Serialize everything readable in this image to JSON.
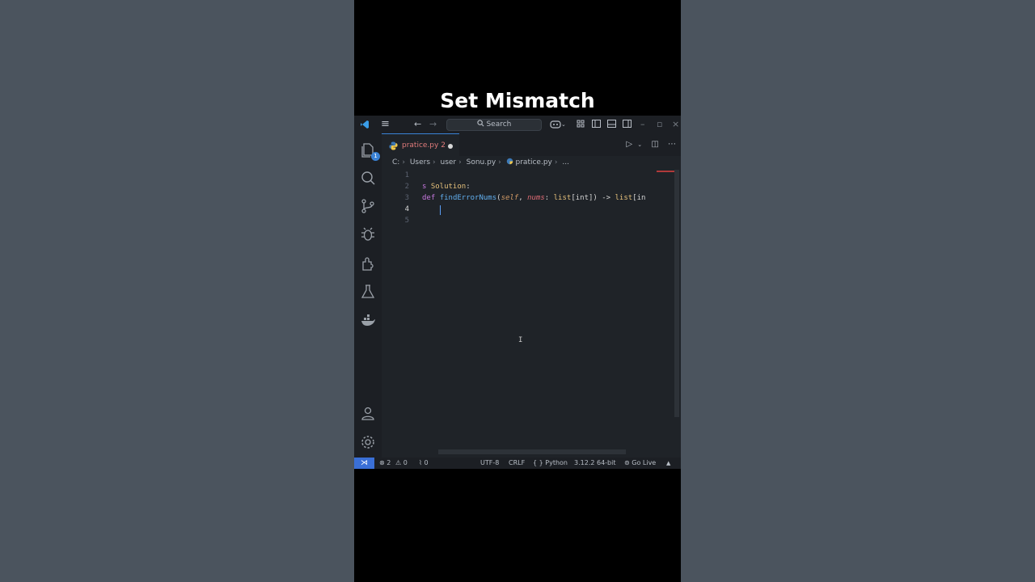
{
  "video": {
    "title": "Set Mismatch"
  },
  "titlebar": {
    "search_placeholder": "Search",
    "back_glyph": "←",
    "forward_glyph": "→",
    "minimize_glyph": "–",
    "maximize_glyph": "▫",
    "close_glyph": "×"
  },
  "activity": {
    "explorer_badge": "1"
  },
  "tab": {
    "label": "pratice.py 2"
  },
  "breadcrumb": {
    "drive": "C:",
    "items": [
      "Users",
      "user",
      "Sonu.py",
      "pratice.py",
      "..."
    ]
  },
  "code": {
    "line_numbers": [
      "1",
      "2",
      "3",
      "4",
      "5"
    ],
    "line2": {
      "keyword": "s",
      "name": "Solution",
      "colon": ":"
    },
    "line3": {
      "def": "def",
      "fn": "findErrorNums",
      "open": "(",
      "self": "self",
      "comma": ", ",
      "param": "nums",
      "colon": ": ",
      "type1": "list",
      "type1_arg": "[int])",
      "arrow": " -> ",
      "type2": "list",
      "type2_arg": "[in"
    }
  },
  "statusbar": {
    "errors": "⊗ 2",
    "warnings": "⚠ 0",
    "ports": "⌇ 0",
    "encoding": "UTF-8",
    "eol": "CRLF",
    "language": "{ } Python",
    "interpreter": "3.12.2 64-bit",
    "golive": "Go Live",
    "bell": "🔔"
  },
  "colors": {
    "accent": "#3a82d6",
    "editor_bg": "#1f2328",
    "keyword": "#c678dd",
    "function": "#61afef",
    "class": "#e5c07b"
  }
}
